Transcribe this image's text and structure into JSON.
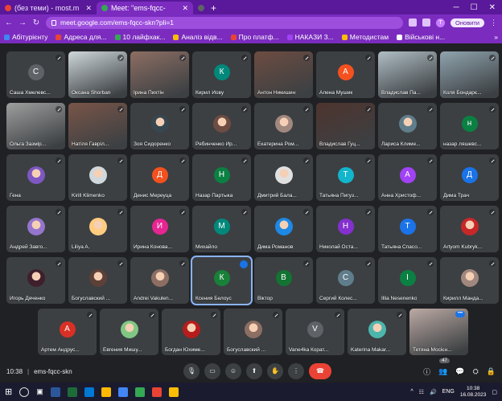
{
  "browser": {
    "tabs": [
      {
        "label": "(без теми) - most.m",
        "color": "#ea4335",
        "active": false
      },
      {
        "label": "Meet: \"ems-fqcc-",
        "color": "#34a853",
        "active": true
      },
      {
        "label": "",
        "color": "#5f6368",
        "active": false
      }
    ],
    "new_tab": "+",
    "url": "meet.google.com/ems-fqcc-skn?pli=1",
    "update_label": "Оновити",
    "profile": "Т",
    "bookmarks": [
      {
        "label": "Абітурієнту",
        "color": "#4285f4"
      },
      {
        "label": "Адреса для...",
        "color": "#ea4335"
      },
      {
        "label": "10 лайфхак...",
        "color": "#34a853"
      },
      {
        "label": "Аналіз відв...",
        "color": "#fbbc04"
      },
      {
        "label": "Про платф...",
        "color": "#ea4335"
      },
      {
        "label": "НАКАЗИ З...",
        "color": "#a142f4"
      },
      {
        "label": "Методистам",
        "color": "#fbbc04"
      },
      {
        "label": "Військові н...",
        "color": "#ffffff"
      }
    ],
    "bookmarks_more": "»"
  },
  "participants": [
    {
      "name": "Саша Хмелевс...",
      "letter": "С",
      "color": "#5f6368",
      "kind": "avatar"
    },
    {
      "name": "Оксана Shorban",
      "kind": "video",
      "color": "#cfd8dc"
    },
    {
      "name": "Ірина Пихтін",
      "kind": "video",
      "color": "#8d6e63"
    },
    {
      "name": "Кирил Йову",
      "letter": "К",
      "color": "#00897b",
      "kind": "avatar"
    },
    {
      "name": "Антон Никишин",
      "kind": "video",
      "color": "#6d4c41"
    },
    {
      "name": "Алена Мушик",
      "letter": "А",
      "color": "#f4511e",
      "kind": "avatar"
    },
    {
      "name": "Владислав Па...",
      "kind": "video",
      "color": "#b0bec5"
    },
    {
      "name": "Коля Бондарє...",
      "kind": "video",
      "color": "#90a4ae"
    },
    {
      "name": "Ольга Зазмір...",
      "kind": "video",
      "color": "#9e9e9e"
    },
    {
      "name": "Натіля Гавріл...",
      "kind": "video",
      "color": "#795548"
    },
    {
      "name": "Зоя Сидоренко",
      "kind": "photo",
      "color": "#37474f"
    },
    {
      "name": "Рябинченко Ир...",
      "kind": "photo",
      "color": "#6d4c41"
    },
    {
      "name": "Екатерина Ром...",
      "kind": "photo",
      "color": "#a1887f"
    },
    {
      "name": "Владислав Гуц...",
      "kind": "video",
      "color": "#4e342e"
    },
    {
      "name": "Лариса Климе...",
      "kind": "photo",
      "color": "#607d8b"
    },
    {
      "name": "назар ляшевс...",
      "letter": "н",
      "color": "#0b8043",
      "kind": "avatar"
    },
    {
      "name": "Гена",
      "kind": "photo",
      "color": "#7e57c2"
    },
    {
      "name": "Kirill Klimenko",
      "kind": "photo",
      "color": "#cfd8dc"
    },
    {
      "name": "Денис Мереуца",
      "letter": "Д",
      "color": "#f4511e",
      "kind": "avatar"
    },
    {
      "name": "Назар Партыка",
      "letter": "Н",
      "color": "#0b8043",
      "kind": "avatar"
    },
    {
      "name": "Дмитрий Бала...",
      "kind": "photo",
      "color": "#e0e0e0"
    },
    {
      "name": "Татьяна Пигуз...",
      "letter": "Т",
      "color": "#12b5cb",
      "kind": "avatar"
    },
    {
      "name": "Анна Христоф...",
      "letter": "А",
      "color": "#a142f4",
      "kind": "avatar"
    },
    {
      "name": "Дима Трач",
      "letter": "Д",
      "color": "#1a73e8",
      "kind": "avatar"
    },
    {
      "name": "Андрей Завго...",
      "kind": "photo",
      "color": "#9575cd"
    },
    {
      "name": "Liliya A.",
      "kind": "photo",
      "color": "#ffcc80"
    },
    {
      "name": "Ирина Конова...",
      "letter": "И",
      "color": "#e52592",
      "kind": "avatar"
    },
    {
      "name": "Михайло",
      "letter": "М",
      "color": "#00897b",
      "kind": "avatar"
    },
    {
      "name": "Дима Романов",
      "kind": "photo",
      "color": "#1e88e5"
    },
    {
      "name": "Николай Оста...",
      "letter": "Н",
      "color": "#8430ce",
      "kind": "avatar"
    },
    {
      "name": "Татьяна Спасо...",
      "letter": "Т",
      "color": "#1a73e8",
      "kind": "avatar"
    },
    {
      "name": "Artyom Kubryk...",
      "kind": "photo",
      "color": "#c62828"
    },
    {
      "name": "Игорь Дяченко",
      "kind": "photo",
      "color": "#3e1f2b"
    },
    {
      "name": "Богуславский ...",
      "kind": "photo",
      "color": "#5d4037"
    },
    {
      "name": "Andrei Vakulen...",
      "kind": "photo",
      "color": "#8d6e63"
    },
    {
      "name": "Ксения Белоус",
      "letter": "К",
      "color": "#188038",
      "kind": "avatar",
      "speaking": true
    },
    {
      "name": "Віктор",
      "letter": "В",
      "color": "#137333",
      "kind": "avatar"
    },
    {
      "name": "Сергий Колес...",
      "letter": "С",
      "color": "#607d8b",
      "kind": "avatar"
    },
    {
      "name": "Illia Nesenenko",
      "letter": "I",
      "color": "#0b8043",
      "kind": "avatar"
    },
    {
      "name": "Кирилл Манда...",
      "kind": "photo",
      "color": "#a1887f"
    }
  ],
  "bottom_row": [
    {
      "name": "Артем Андрус...",
      "letter": "А",
      "color": "#d93025",
      "kind": "avatar"
    },
    {
      "name": "Евгения Мишу...",
      "kind": "photo",
      "color": "#81c784"
    },
    {
      "name": "Богдан Юхиме...",
      "kind": "photo",
      "color": "#b71c1c"
    },
    {
      "name": "Богуславский ...",
      "kind": "photo",
      "color": "#8d6e63"
    },
    {
      "name": "Vane4ka Корат...",
      "letter": "V",
      "color": "#5f6368",
      "kind": "avatar"
    },
    {
      "name": "Katerina Makar...",
      "kind": "photo",
      "color": "#4db6ac"
    },
    {
      "name": "Тетяна Мосієн...",
      "kind": "video",
      "color": "#bcaaa4",
      "self": true
    }
  ],
  "meeting": {
    "time": "10:38",
    "code": "ems-fqcc-skn",
    "participant_count": "47",
    "end_icon": "☎"
  },
  "taskbar": {
    "lang": "ENG",
    "time": "10:38",
    "date": "16.08.2023",
    "apps": [
      "#2b579a",
      "#1e6b3a",
      "#0078d4",
      "#ffb900",
      "#4285f4",
      "#34a853",
      "#ea4335",
      "#fbbc04"
    ]
  }
}
